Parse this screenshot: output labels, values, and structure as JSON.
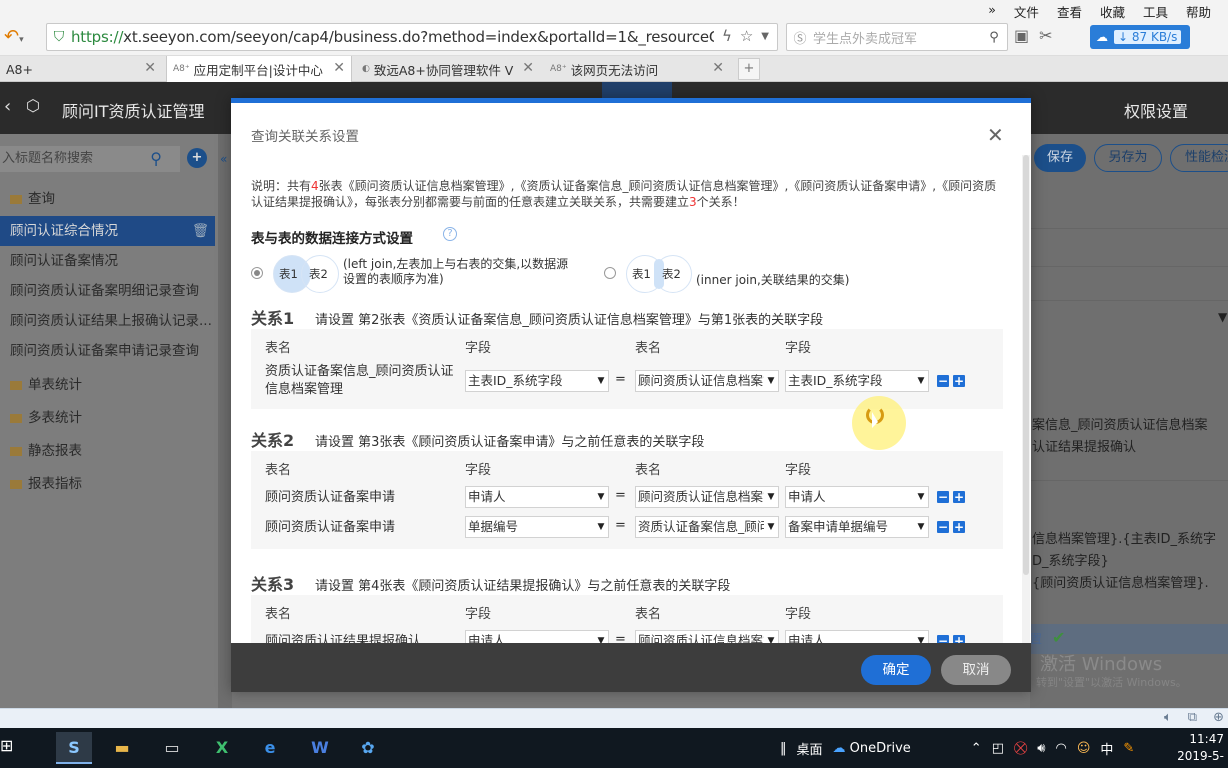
{
  "browser": {
    "menus": [
      "»",
      "文件",
      "查看",
      "收藏",
      "工具",
      "帮助"
    ],
    "url_prefix": "https://",
    "url_rest": "xt.seeyon.com/seeyon/cap4/business.do?method=index&portalId=1&_resourceCode=T",
    "search_placeholder": "学生点外卖成冠军",
    "speed": "87 KB/s",
    "tabs": [
      {
        "label": "A8+"
      },
      {
        "label": "应用定制平台|设计中心"
      },
      {
        "label": "致远A8+协同管理软件 V"
      },
      {
        "label": "该网页无法访问"
      }
    ]
  },
  "app": {
    "title": "顾问IT资质认证管理",
    "permission_settings": "权限设置",
    "save": "保存",
    "save_as": "另存为",
    "perf": "性能检测"
  },
  "sidebar": {
    "search_placeholder": "入标题名称搜索",
    "items": [
      {
        "label": "查询",
        "type": "folder"
      },
      {
        "label": "顾问认证综合情况",
        "type": "item",
        "active": true
      },
      {
        "label": "顾问认证备案情况",
        "type": "item"
      },
      {
        "label": "顾问资质认证备案明细记录查询",
        "type": "item"
      },
      {
        "label": "顾问资质认证结果上报确认记录...",
        "type": "item"
      },
      {
        "label": "顾问资质认证备案申请记录查询",
        "type": "item"
      },
      {
        "label": "单表统计",
        "type": "folder"
      },
      {
        "label": "多表统计",
        "type": "folder"
      },
      {
        "label": "静态报表",
        "type": "folder"
      },
      {
        "label": "报表指标",
        "type": "folder"
      }
    ]
  },
  "right_panel": {
    "line1": "案信息_顾问资质认证信息档案",
    "line2": "认证结果提报确认",
    "line3": "信息档案管理}.{主表ID_系统字",
    "line4": "D_系统字段}",
    "line5": "{顾问资质认证信息档案管理}.",
    "strip_text": "置",
    "watermark": "激活 Windows",
    "watermark_sub": "转到\"设置\"以激活 Windows。"
  },
  "modal": {
    "title": "查询关联关系设置",
    "desc_prefix": "说明：共有",
    "desc_count": "4",
    "desc_mid": "张表《顾问资质认证信息档案管理》,《资质认证备案信息_顾问资质认证信息档案管理》,《顾问资质认证备案申请》,《顾问资质认证结果提报确认》，每张表分别都需要与前面的任意表建立关联关系，共需要建立",
    "desc_rel_count": "3",
    "desc_suffix": "个关系！",
    "join_title": "表与表的数据连接方式设置",
    "table1": "表1",
    "table2": "表2",
    "left_join_desc": "(left join,左表加上与右表的交集,以数据源设置的表顺序为准)",
    "inner_join_desc": "(inner join,关联结果的交集)",
    "col_table": "表名",
    "col_field": "字段",
    "equals": "=",
    "ok": "确定",
    "cancel": "取消",
    "relations": [
      {
        "name": "关系1",
        "instruction": "请设置 第2张表《资质认证备案信息_顾问资质认证信息档案管理》与第1张表的关联字段",
        "rows": [
          {
            "table": "资质认证备案信息_顾问资质认证信息档案管理",
            "field": "主表ID_系统字段",
            "target_table": "顾问资质认证信息档案管理",
            "target_field": "主表ID_系统字段"
          }
        ]
      },
      {
        "name": "关系2",
        "instruction": "请设置 第3张表《顾问资质认证备案申请》与之前任意表的关联字段",
        "rows": [
          {
            "table": "顾问资质认证备案申请",
            "field": "申请人",
            "target_table": "顾问资质认证信息档案管理",
            "target_field": "申请人"
          },
          {
            "table": "顾问资质认证备案申请",
            "field": "单据编号",
            "target_table": "资质认证备案信息_顾问资质认证信息档案管理",
            "target_field": "备案申请单据编号"
          }
        ]
      },
      {
        "name": "关系3",
        "instruction": "请设置 第4张表《顾问资质认证结果提报确认》与之前任意表的关联字段",
        "rows": [
          {
            "table": "顾问资质认证结果提报确认",
            "field": "申请人",
            "target_table": "顾问资质认证信息档案管理",
            "target_field": "申请人"
          }
        ]
      }
    ]
  },
  "taskbar": {
    "desktop": "桌面",
    "onedrive": "OneDrive",
    "ime": "中",
    "time": "11:47",
    "date": "2019-5-"
  }
}
